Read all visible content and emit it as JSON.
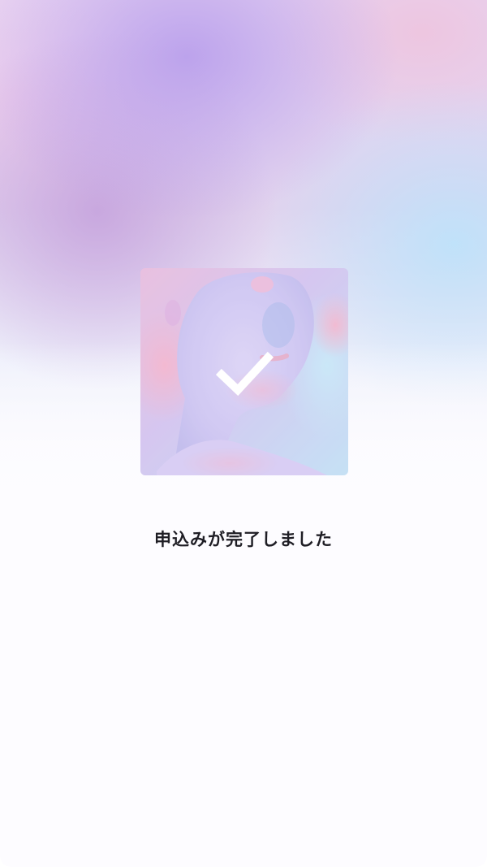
{
  "completion": {
    "message": "申込みが完了しました",
    "status_icon": "checkmark-icon",
    "image": "portrait-thumbnail"
  },
  "colors": {
    "text": "#1e1d24",
    "lavender": "#bfa8ee",
    "sky": "#bfe2fa",
    "pink": "#f2b6cf"
  }
}
